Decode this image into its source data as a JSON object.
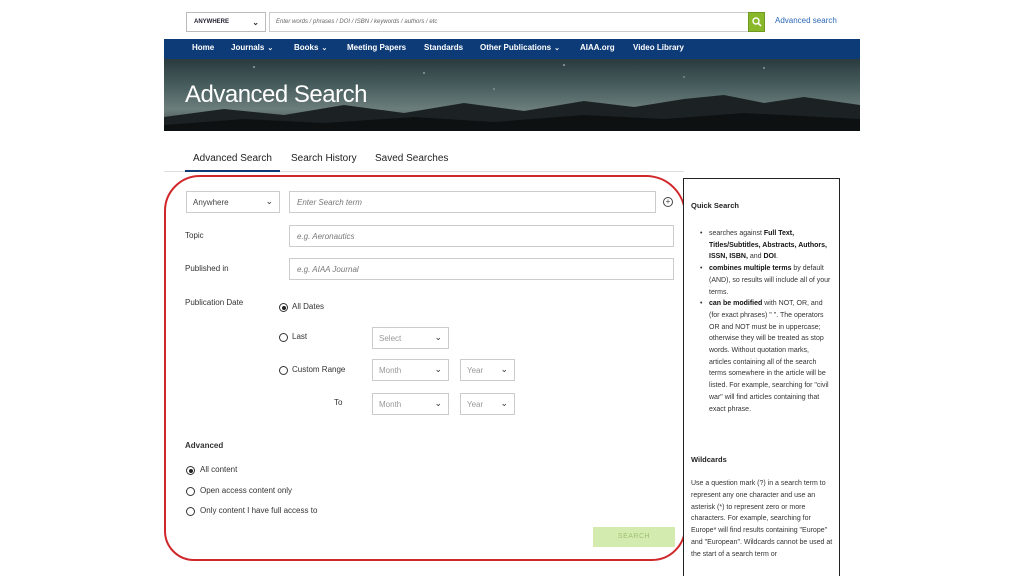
{
  "topbar": {
    "scope": "ANYWHERE",
    "search_placeholder": "Enter words / phrases / DOI / ISBN / keywords / authors / etc",
    "advanced_link": "Advanced search"
  },
  "nav": {
    "items": [
      {
        "label": "Home",
        "dropdown": false
      },
      {
        "label": "Journals",
        "dropdown": true
      },
      {
        "label": "Books",
        "dropdown": true
      },
      {
        "label": "Meeting Papers",
        "dropdown": false
      },
      {
        "label": "Standards",
        "dropdown": false
      },
      {
        "label": "Other Publications",
        "dropdown": true
      },
      {
        "label": "AIAA.org",
        "dropdown": false
      },
      {
        "label": "Video Library",
        "dropdown": false
      }
    ]
  },
  "banner": {
    "title": "Advanced Search"
  },
  "tabs": [
    "Advanced Search",
    "Search History",
    "Saved Searches"
  ],
  "form": {
    "field_select": "Anywhere",
    "search_term_placeholder": "Enter Search term",
    "topic_label": "Topic",
    "topic_placeholder": "e.g. Aeronautics",
    "published_in_label": "Published in",
    "published_in_placeholder": "e.g. AIAA Journal",
    "publication_date_label": "Publication Date",
    "date_options": {
      "all_dates": "All Dates",
      "last": "Last",
      "custom_range": "Custom Range",
      "to": "To"
    },
    "last_select": "Select",
    "month_select": "Month",
    "year_select": "Year",
    "advanced_label": "Advanced",
    "access_options": [
      "All content",
      "Open access content only",
      "Only content I have full access to"
    ],
    "search_button": "SEARCH"
  },
  "sidebar": {
    "quick_search_heading": "Quick Search",
    "bullets": {
      "b1_pre": "searches against ",
      "b1_bold": "Full Text, Titles/Subtitles, Abstracts, Authors, ISSN, ISBN,",
      "b1_and": " and ",
      "b1_doi": "DOI",
      "b1_end": ".",
      "b2_bold": "combines multiple terms",
      "b2_rest": " by default (AND), so results will include all of your terms.",
      "b3_bold": "can be modified",
      "b3_rest": " with NOT, OR, and (for exact phrases) \" \". The operators OR and NOT must be in uppercase; otherwise they will be treated as stop words. Without quotation marks, articles containing all of the search terms somewhere in the article will be listed. For example, searching for \"civil war\" will find articles containing that exact phrase."
    },
    "wildcards_heading": "Wildcards",
    "wildcards_text": "Use a question mark (?) in a search term to represent any one character and use an asterisk (*) to represent zero or more characters. For example, searching for Europe* will find results containing \"Europe\" and \"European\". Wildcards cannot be used at the start of a search term or"
  },
  "colors": {
    "nav_bg": "#0d3b78",
    "go_button": "#8ab82b",
    "annotation": "#d0272b",
    "search_button_bg": "#d4ebb0"
  }
}
